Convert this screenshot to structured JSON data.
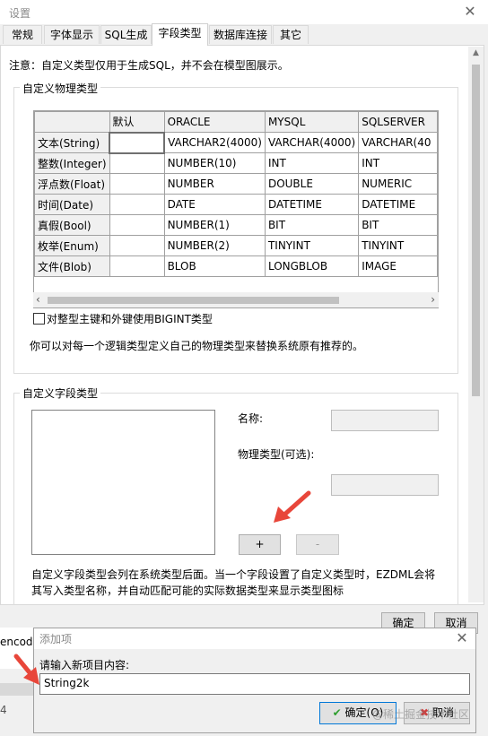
{
  "window": {
    "title": "设置",
    "close_glyph": "✕"
  },
  "tabs": [
    {
      "label": "常规"
    },
    {
      "label": "字体显示"
    },
    {
      "label": "SQL生成"
    },
    {
      "label": "字段类型"
    },
    {
      "label": "数据库连接"
    },
    {
      "label": "其它"
    }
  ],
  "notice": "注意：自定义类型仅用于生成SQL，并不会在模型图展示。",
  "physical_group": {
    "label": "自定义物理类型",
    "columns": [
      "",
      "默认",
      "ORACLE",
      "MYSQL",
      "SQLSERVER"
    ],
    "rows": [
      {
        "name": "文本(String)",
        "default": "",
        "oracle": "VARCHAR2(4000)",
        "mysql": "VARCHAR(4000)",
        "sqlserver": "VARCHAR(40"
      },
      {
        "name": "整数(Integer)",
        "default": "",
        "oracle": "NUMBER(10)",
        "mysql": "INT",
        "sqlserver": "INT"
      },
      {
        "name": "浮点数(Float)",
        "default": "",
        "oracle": "NUMBER",
        "mysql": "DOUBLE",
        "sqlserver": "NUMERIC"
      },
      {
        "name": "时间(Date)",
        "default": "",
        "oracle": "DATE",
        "mysql": "DATETIME",
        "sqlserver": "DATETIME"
      },
      {
        "name": "真假(Bool)",
        "default": "",
        "oracle": "NUMBER(1)",
        "mysql": "BIT",
        "sqlserver": "BIT"
      },
      {
        "name": "枚举(Enum)",
        "default": "",
        "oracle": "NUMBER(2)",
        "mysql": "TINYINT",
        "sqlserver": "TINYINT"
      },
      {
        "name": "文件(Blob)",
        "default": "",
        "oracle": "BLOB",
        "mysql": "LONGBLOB",
        "sqlserver": "IMAGE"
      }
    ],
    "bigint_checkbox_label": "对整型主键和外键使用BIGINT类型",
    "bigint_checked": false,
    "hint": "你可以对每一个逻辑类型定义自己的物理类型来替换系统原有推荐的。"
  },
  "field_group": {
    "label": "自定义字段类型",
    "name_label": "名称:",
    "phys_label": "物理类型(可选):",
    "add_button": "+",
    "remove_button": "-",
    "description": "自定义字段类型会列在系统类型后面。当一个字段设置了自定义类型时，EZDML会将其写入类型名称，并自动匹配可能的实际数据类型来显示类型图标"
  },
  "footer": {
    "ok": "确定",
    "cancel": "取消"
  },
  "background_text": "encod",
  "background_digit": "4",
  "dialog": {
    "title": "添加项",
    "prompt": "请输入新项目内容:",
    "value": "String2k",
    "ok": "确定(O)",
    "cancel": "取消",
    "close_glyph": "✕"
  },
  "watermark": "@稀土掘金技术社区",
  "colors": {
    "annotation_arrow": "#e8463a",
    "ok_check": "#2e9e2e",
    "cancel_x": "#d23c3c"
  }
}
